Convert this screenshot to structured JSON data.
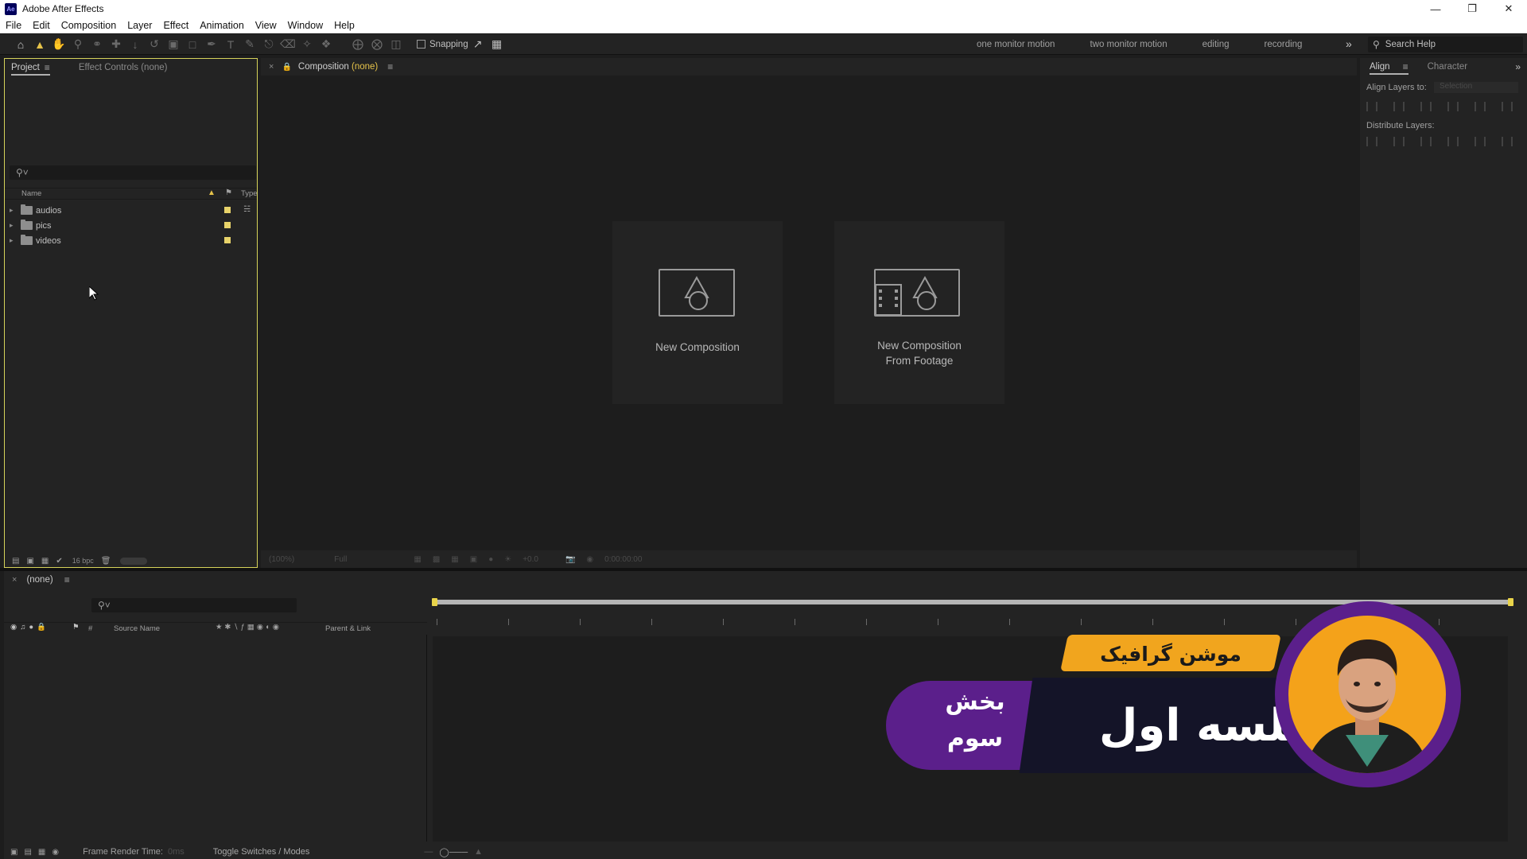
{
  "window": {
    "title": "Adobe After Effects",
    "app_icon": "Ae",
    "controls": [
      "minimize-icon",
      "restore-icon",
      "close-icon"
    ]
  },
  "menu": [
    "File",
    "Edit",
    "Composition",
    "Layer",
    "Effect",
    "Animation",
    "View",
    "Window",
    "Help"
  ],
  "toolbar": {
    "snapping_label": "Snapping",
    "workspaces": [
      "one monitor motion",
      "two monitor motion",
      "editing",
      "recording"
    ],
    "search_placeholder": "Search Help"
  },
  "project_panel": {
    "tabs": [
      "Project",
      "Effect Controls (none)"
    ],
    "columns": {
      "name": "Name",
      "type": "Type"
    },
    "folders": [
      {
        "name": "audios",
        "label_color": "#e8d36a"
      },
      {
        "name": "pics",
        "label_color": "#e8d36a"
      },
      {
        "name": "videos",
        "label_color": "#e8d36a"
      }
    ],
    "bit_depth": "16 bpc"
  },
  "composition_panel": {
    "tab_prefix": "Composition",
    "tab_value": "(none)",
    "tiles": [
      {
        "label_line1": "New Composition",
        "label_line2": ""
      },
      {
        "label_line1": "New Composition",
        "label_line2": "From Footage"
      }
    ],
    "footer": {
      "zoom": "(100%)",
      "resolution": "Full",
      "exposure": "+0.0",
      "timecode": "0:00:00:00"
    }
  },
  "align_panel": {
    "tabs": [
      "Align",
      "Character"
    ],
    "align_layers_to": "Align Layers to:",
    "selection": "Selection",
    "distribute_layers": "Distribute Layers:"
  },
  "timeline_panel": {
    "tab_title": "(none)",
    "columns": {
      "source_name": "Source Name",
      "parent_link": "Parent & Link"
    },
    "frame_render_label": "Frame Render Time:",
    "frame_render_value": "0ms",
    "toggle_label": "Toggle Switches / Modes"
  },
  "overlay": {
    "orange_text": "موشن گرافیک",
    "main_text": "جلسه اول",
    "side_line1": "بخش",
    "side_line2": "سوم",
    "colors": {
      "purple": "#5b1f8b",
      "orange": "#f1a51e",
      "navy": "#141428"
    }
  },
  "colors": {
    "accent_yellow": "#e6c34a",
    "panel_bg": "#232323",
    "viewer_bg": "#1d1d1d"
  }
}
